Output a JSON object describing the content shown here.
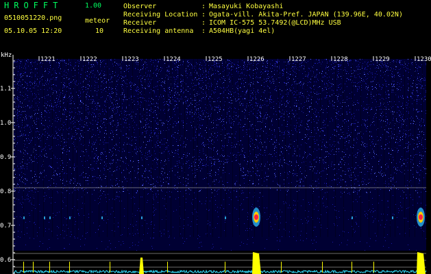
{
  "header": {
    "app_title": "HROFFT",
    "app_version": "1.00",
    "filename": "0510051220.png",
    "mode_label": "meteor",
    "timestamp": "05.10.05 12:20",
    "mode_value": "10"
  },
  "info": {
    "separator": ":",
    "rows": [
      {
        "key": "Observer",
        "value": "Masayuki Kobayashi"
      },
      {
        "key": "Receiving Location",
        "value": "Ogata-vill. Akita-Pref. JAPAN (139.96E, 40.02N)"
      },
      {
        "key": "Receiver",
        "value": "ICOM IC-575 53.7492(@LCD)MHz USB"
      },
      {
        "key": "Receiving antenna",
        "value": "A504HB(yagi 4el)"
      }
    ]
  },
  "spectrogram": {
    "unit_label": "kHz",
    "freq_ticks": [
      "1.1",
      "1.0",
      "0.9",
      "0.8",
      "0.7",
      "0.6"
    ],
    "time_ticks": [
      "1221",
      "1222",
      "1223",
      "1224",
      "1225",
      "1226",
      "1227",
      "1228",
      "1229",
      "1230"
    ],
    "meteor_echo_times": [
      "1226",
      "1230"
    ],
    "colors": {
      "background": "#000033",
      "noise": "#1a1aaa",
      "noise_bright": "#5a6aff",
      "echo_core": "#ff2040",
      "echo_edge": "#30c0ff",
      "level_trace": "#33e0ff",
      "level_peak": "#ffff00",
      "grid": "#9a9a9a",
      "axis": "#ffffff"
    }
  }
}
